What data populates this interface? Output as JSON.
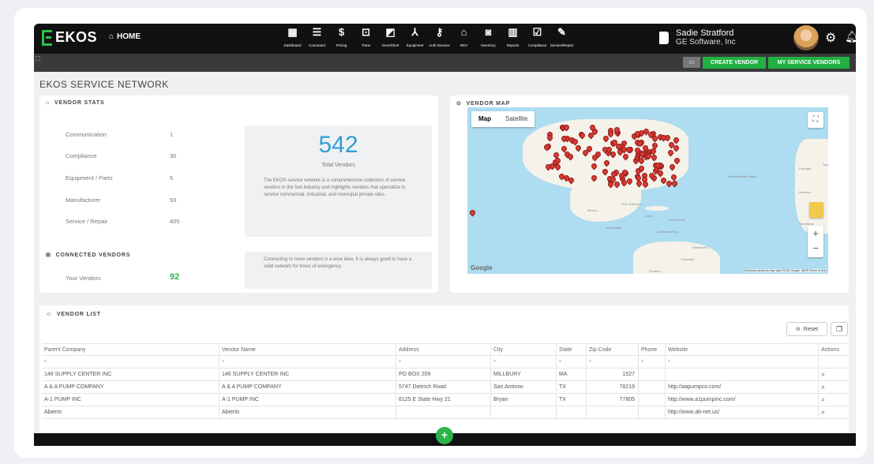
{
  "header": {
    "logo_text": "EKOS",
    "home_label": "HOME",
    "nav": [
      {
        "icon": "dashboard-icon",
        "glyph": "▦",
        "label": "Dashboard"
      },
      {
        "icon": "command-icon",
        "glyph": "☰",
        "label": "Command"
      },
      {
        "icon": "pricing-icon",
        "glyph": "$",
        "label": "Pricing"
      },
      {
        "icon": "trans-icon",
        "glyph": "⊡",
        "label": "Trans"
      },
      {
        "icon": "overshort-icon",
        "glyph": "◩",
        "label": "Over/Short"
      },
      {
        "icon": "equipment-icon",
        "glyph": "⅄",
        "label": "Equipment"
      },
      {
        "icon": "auth-devices-icon",
        "glyph": "⚷",
        "label": "Auth Devices"
      },
      {
        "icon": "rev-icon",
        "glyph": "⌂",
        "label": "REV"
      },
      {
        "icon": "inventory-icon",
        "glyph": "◙",
        "label": "Inventory"
      },
      {
        "icon": "reports-icon",
        "glyph": "▥",
        "label": "Reports"
      },
      {
        "icon": "compliance-icon",
        "glyph": "☑",
        "label": "Compliance"
      },
      {
        "icon": "service-repair-icon",
        "glyph": "✎",
        "label": "Service/Repair"
      }
    ],
    "user_name": "Sadie Stratford",
    "user_org": "GE Software, Inc"
  },
  "subbar": {
    "create_vendor": "CREATE VENDOR",
    "my_service_vendors": "MY SERVICE VENDORS"
  },
  "page_title": "EKOS SERVICE NETWORK",
  "vendor_stats": {
    "heading": "VENDOR STATS",
    "items": [
      {
        "label": "Communication",
        "value": "1"
      },
      {
        "label": "Compliance",
        "value": "30"
      },
      {
        "label": "Equipment / Parts",
        "value": "5"
      },
      {
        "label": "Manufacturer",
        "value": "93"
      },
      {
        "label": "Service / Repair",
        "value": "405"
      }
    ],
    "total": "542",
    "total_label": "Total Vendors",
    "description": "The EKOS service network is a comprehensive collection of service vendors in the fuel industry and highlights vendors that specialize in service commercial, industrial, and municipal private sites."
  },
  "connected_vendors": {
    "heading": "CONNECTED VENDORS",
    "label": "Your Vendors",
    "value": "92",
    "note": "Connecting to more vendors is a wise idea. It is always good to have a solid network for times of emergency."
  },
  "vendor_map": {
    "heading": "VENDOR MAP",
    "tab_map": "Map",
    "tab_satellite": "Satellite",
    "labels": [
      "Mexico",
      "North Atlantic Ocean",
      "Portugal",
      "Morocco",
      "Gulf of Mexico",
      "Cuba",
      "Puerto Rico",
      "Guatemala",
      "Caribbean Sea",
      "Venezuela",
      "Colombia",
      "Ecuador",
      "Mauritania",
      "Spa"
    ],
    "footer": "Keyboard shortcuts   Map data ©2021 Google, INEGI   Terms of Use",
    "google": "Google"
  },
  "vendor_list": {
    "heading": "VENDOR LIST",
    "reset_label": "Reset",
    "columns": [
      "Parent Company",
      "Vendor Name",
      "Address",
      "City",
      "State",
      "Zip Code",
      "Phone",
      "Website",
      "Actions"
    ],
    "rows": [
      [
        "146 SUPPLY CENTER INC",
        "146 SUPPLY CENTER INC",
        "PO BOX 209",
        "MILLBURY",
        "MA",
        "1527",
        "",
        ""
      ],
      [
        "A & A PUMP COMPANY",
        "A & A PUMP COMPANY",
        "5747 Dietrich Road",
        "San Antonio",
        "TX",
        "78219",
        "",
        "http://aapumpco.com/"
      ],
      [
        "A-1 PUMP INC",
        "A-1 PUMP INC",
        "6125 E State Hwy 21",
        "Bryan",
        "TX",
        "77805",
        "",
        "http://www.a1pumpinc.com/"
      ],
      [
        "Abierto",
        "Abierto",
        "",
        "",
        "",
        "",
        "",
        "http://www.ab-net.us/"
      ]
    ]
  }
}
